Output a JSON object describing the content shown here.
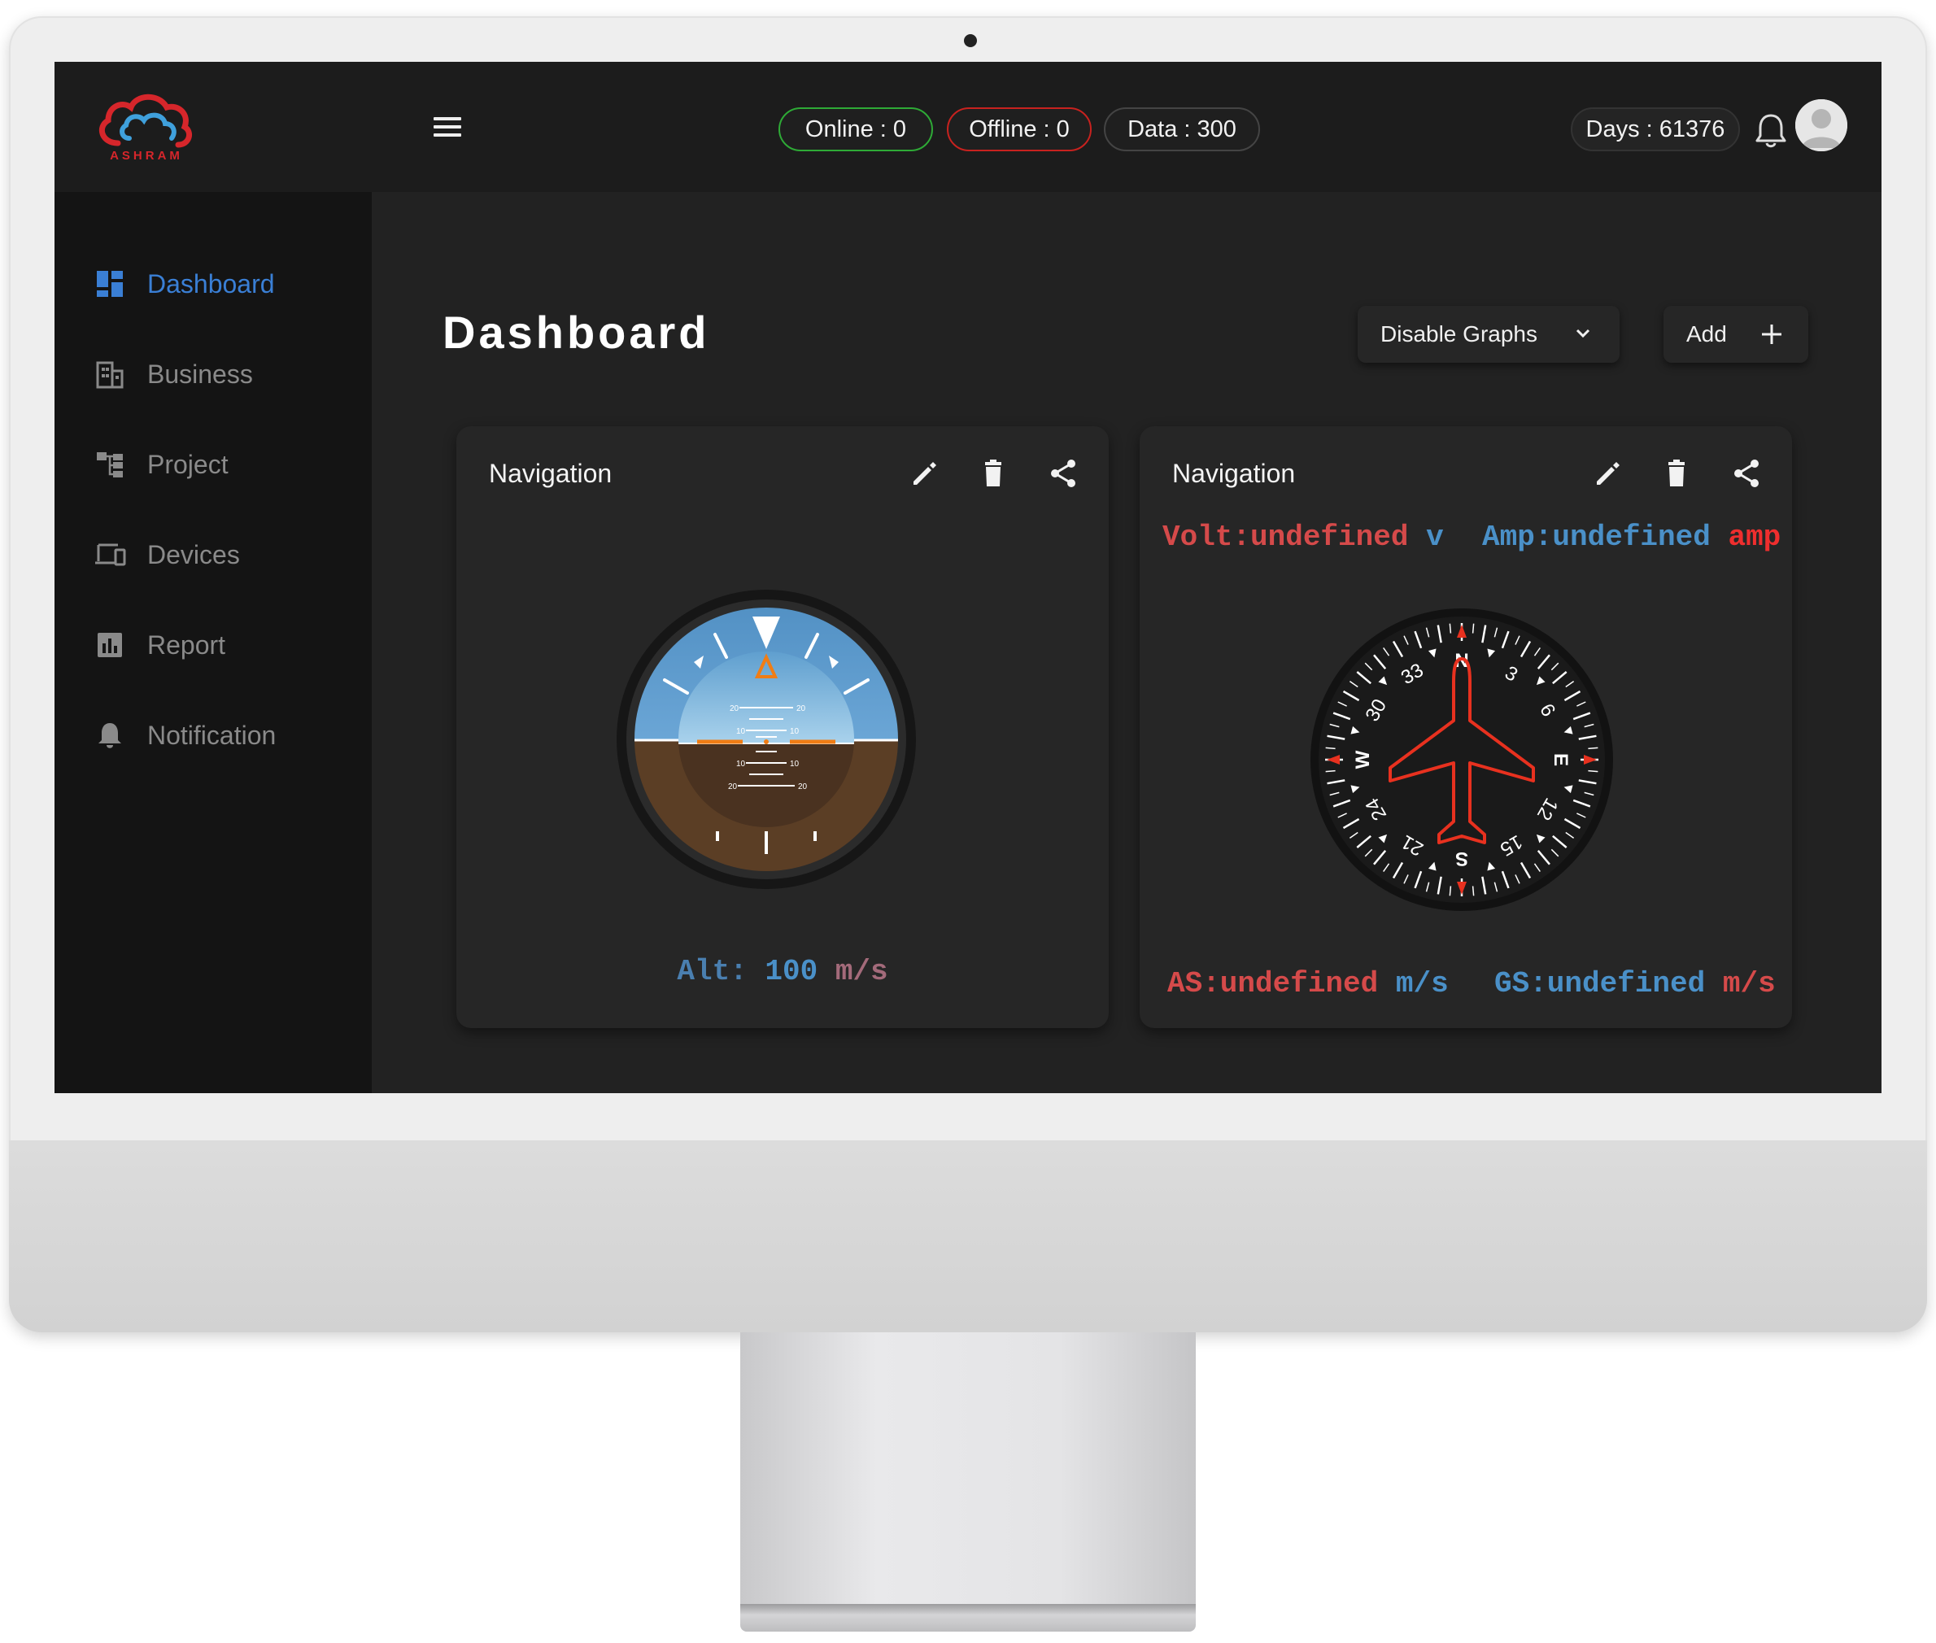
{
  "brand": {
    "logo_text": "ASHRAM"
  },
  "header": {
    "online_label": "Online  :  0",
    "offline_label": "Offline : 0",
    "data_label": "Data : 300",
    "days_label": "Days : 61376"
  },
  "sidebar": {
    "items": [
      {
        "label": "Dashboard",
        "icon": "dashboard-icon",
        "active": true
      },
      {
        "label": "Business",
        "icon": "business-icon",
        "active": false
      },
      {
        "label": "Project",
        "icon": "project-icon",
        "active": false
      },
      {
        "label": "Devices",
        "icon": "devices-icon",
        "active": false
      },
      {
        "label": "Report",
        "icon": "report-icon",
        "active": false
      },
      {
        "label": "Notification",
        "icon": "bell-icon",
        "active": false
      }
    ]
  },
  "main": {
    "title": "Dashboard",
    "disable_graphs_label": "Disable Graphs",
    "add_label": "Add"
  },
  "cards": [
    {
      "title": "Navigation",
      "gauge": "attitude-indicator",
      "pitch_labels": [
        "20",
        "10",
        "10",
        "20"
      ],
      "alt_label": "Alt:",
      "alt_value": "100",
      "alt_unit": "m/s"
    },
    {
      "title": "Navigation",
      "gauge": "heading-indicator",
      "volt_label": "Volt:undefined",
      "volt_unit": "v",
      "amp_label": "Amp:undefined",
      "amp_unit": "amp",
      "as_label": "AS:undefined",
      "as_unit": "m/s",
      "gs_label": "GS:undefined",
      "gs_unit": "m/s",
      "compass_labels": [
        "N",
        "3",
        "6",
        "E",
        "12",
        "15",
        "S",
        "21",
        "24",
        "W",
        "30",
        "33"
      ]
    }
  ],
  "colors": {
    "accent": "#3a7fd5",
    "online_border": "#2eaa36",
    "offline_border": "#c8221f",
    "background": "#222222",
    "sidebar": "#141414"
  }
}
